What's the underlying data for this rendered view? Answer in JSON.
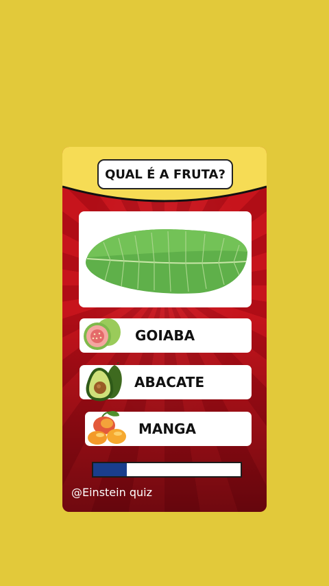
{
  "quiz": {
    "title": "QUAL É A FRUTA?",
    "question_image": "leaf-image",
    "options": [
      {
        "label": "GOIABA",
        "icon": "guava-icon"
      },
      {
        "label": "ABACATE",
        "icon": "avocado-icon"
      },
      {
        "label": "MANGA",
        "icon": "mango-icon"
      }
    ],
    "timer_progress": 0.23,
    "credit": "@Einstein quiz"
  },
  "colors": {
    "background": "#e2c93a",
    "header": "#f6dc55",
    "card_red": "#c7141c",
    "progress_fill": "#1a3e8c"
  }
}
